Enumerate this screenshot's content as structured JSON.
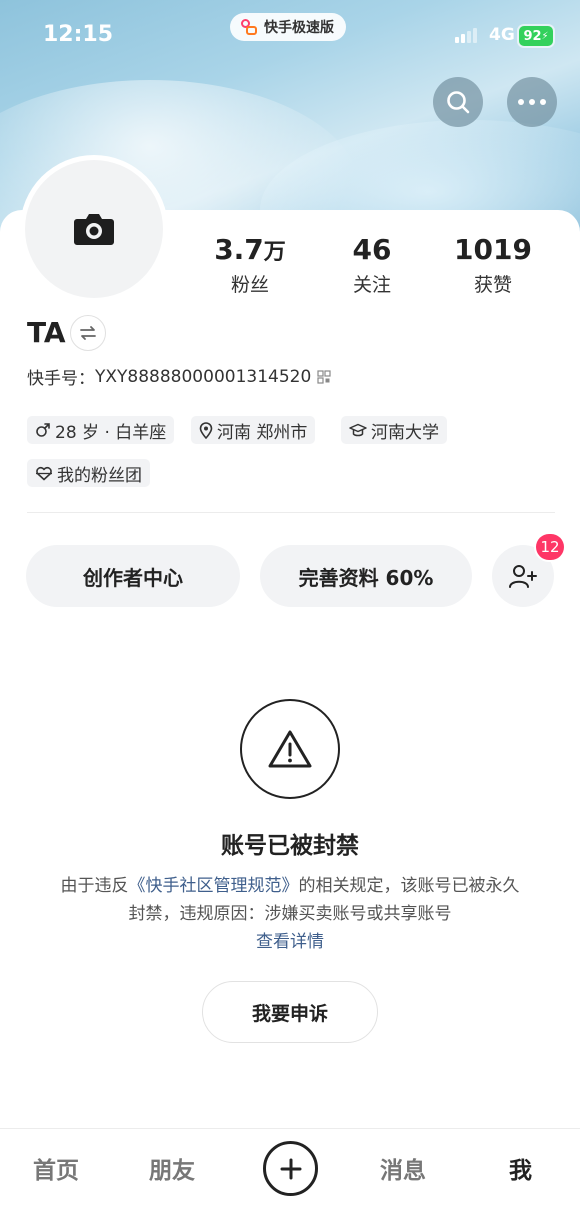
{
  "status_bar": {
    "time": "12:15",
    "app_name": "快手极速版",
    "network": "4G",
    "battery": "92"
  },
  "profile": {
    "nickname": "TA",
    "user_id_label": "快手号：",
    "user_id": "YXY88888000001314520",
    "stats": [
      {
        "value": "3.7",
        "unit": "万",
        "label": "粉丝"
      },
      {
        "value": "46",
        "unit": "",
        "label": "关注"
      },
      {
        "value": "1019",
        "unit": "",
        "label": "获赞"
      }
    ],
    "tags": {
      "age": "28 岁 · 白羊座",
      "location": "河南 郑州市",
      "school": "河南大学",
      "fan_club": "我的粉丝团"
    }
  },
  "actions": {
    "creator_center": "创作者中心",
    "complete_profile": "完善资料 60%",
    "friend_badge": "12"
  },
  "ban_notice": {
    "title": "账号已被封禁",
    "desc_prefix": "由于违反",
    "rules_link": "《快手社区管理规范》",
    "desc_suffix": "的相关规定，该账号已被永久封禁，违规原因：涉嫌买卖账号或共享账号",
    "details_link": "查看详情",
    "appeal_button": "我要申诉"
  },
  "tabbar": {
    "home": "首页",
    "friends": "朋友",
    "messages": "消息",
    "me": "我"
  },
  "colors": {
    "accent_link": "#3f5f8c",
    "badge": "#fe3666",
    "battery": "#33d15c"
  }
}
